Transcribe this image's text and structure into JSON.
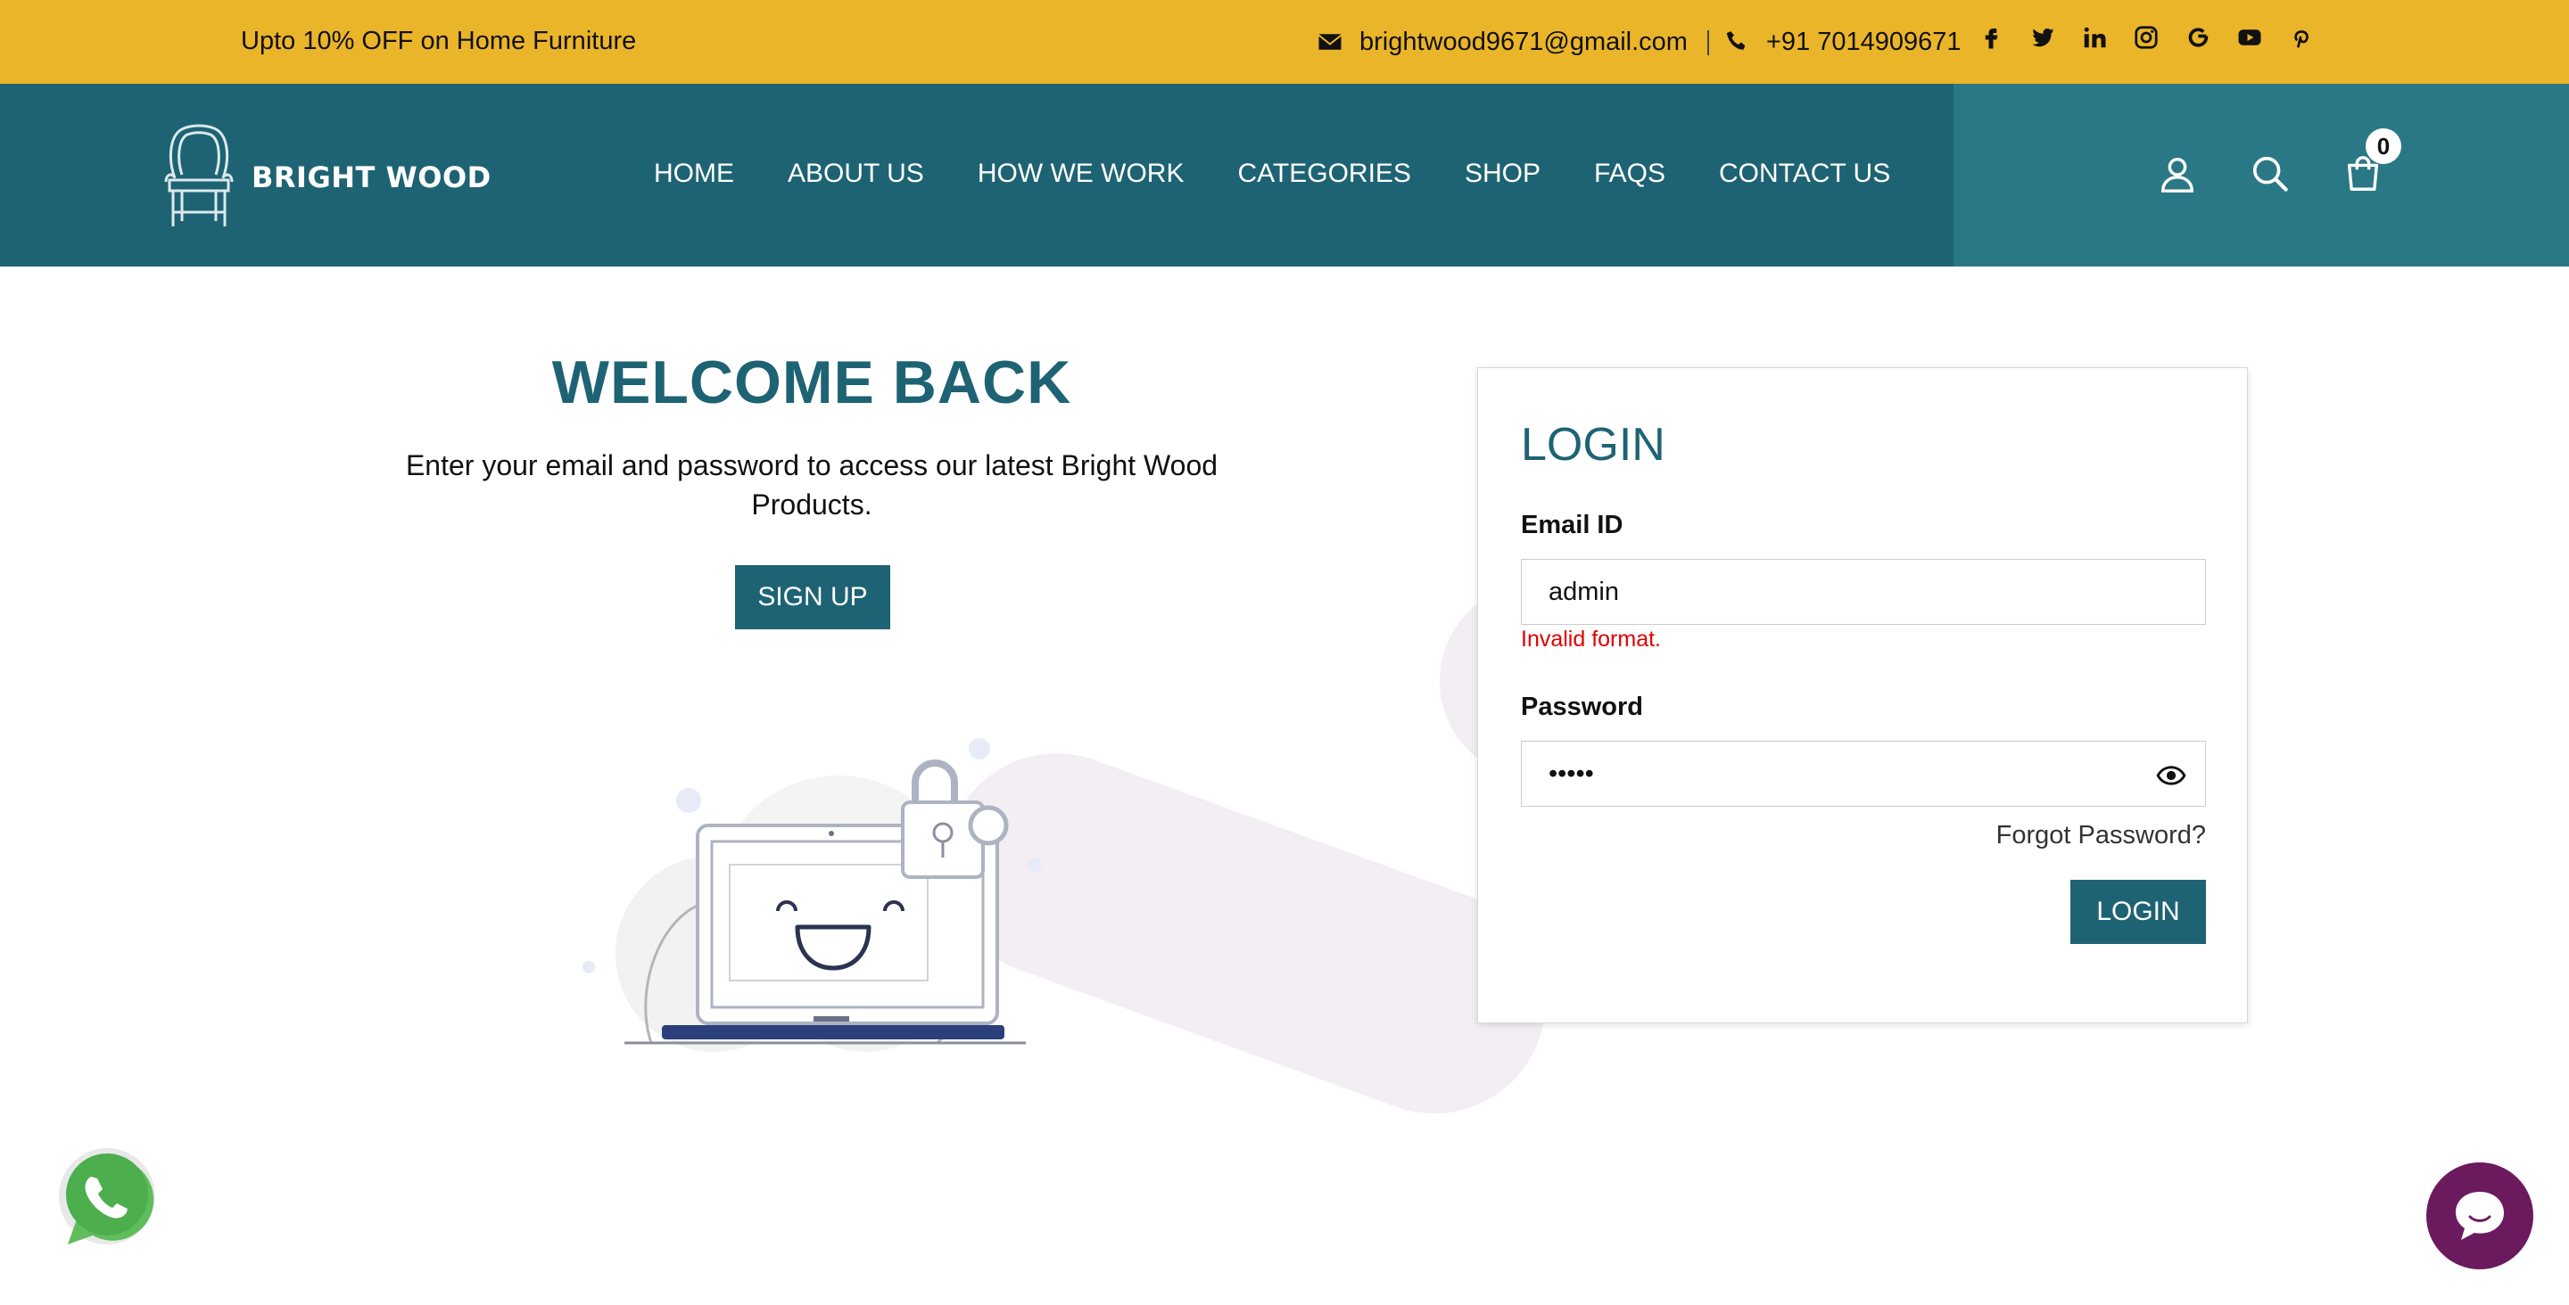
{
  "topbar": {
    "promo": "Upto 10% OFF on Home Furniture",
    "email": "brightwood9671@gmail.com",
    "phone": "+91 7014909671",
    "socials": [
      "facebook-icon",
      "twitter-icon",
      "linkedin-icon",
      "instagram-icon",
      "google-icon",
      "youtube-icon",
      "pinterest-icon"
    ]
  },
  "brand": {
    "name": "BRIGHT WOOD"
  },
  "nav": {
    "items": [
      "HOME",
      "ABOUT US",
      "HOW WE WORK",
      "CATEGORIES",
      "SHOP",
      "FAQS",
      "CONTACT US"
    ],
    "cart_count": "0"
  },
  "welcome": {
    "title": "WELCOME BACK",
    "text": "Enter your email and password to access our latest Bright Wood Products.",
    "signup_label": "SIGN UP"
  },
  "login": {
    "title": "LOGIN",
    "email_label": "Email ID",
    "email_value": "admin",
    "email_error": "Invalid format.",
    "password_label": "Password",
    "password_value": "•••••",
    "forgot_label": "Forgot Password?",
    "submit_label": "LOGIN"
  },
  "colors": {
    "topbar": "#ebb52a",
    "nav": "#1e6373",
    "nav_right": "#2a7886",
    "error": "#e00000",
    "chat": "#6b1a5e"
  }
}
